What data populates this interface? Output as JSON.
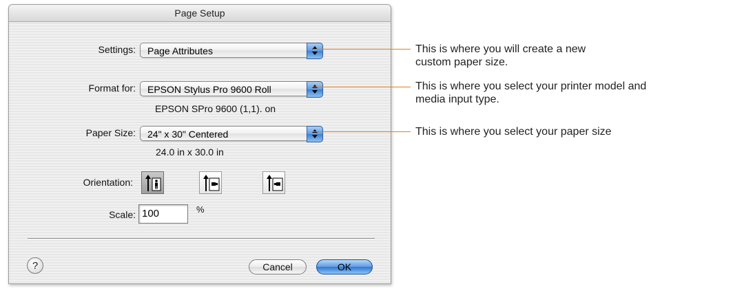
{
  "dialog": {
    "title": "Page Setup",
    "settings": {
      "label": "Settings:",
      "value": "Page Attributes"
    },
    "format_for": {
      "label": "Format for:",
      "value": "EPSON Stylus Pro 9600 Roll",
      "info": "EPSON SPro 9600 (1,1). on"
    },
    "paper_size": {
      "label": "Paper Size:",
      "value": "24\" x 30\" Centered",
      "info": "24.0 in x 30.0 in"
    },
    "orientation": {
      "label": "Orientation:",
      "options": [
        "portrait-icon",
        "landscape-icon",
        "reverse-landscape-icon"
      ],
      "selected": 0
    },
    "scale": {
      "label": "Scale:",
      "value": "100",
      "unit": "%"
    },
    "help_label": "?",
    "cancel_label": "Cancel",
    "ok_label": "OK"
  },
  "annotations": {
    "settings": [
      "This is where you will create a new",
      "custom paper size."
    ],
    "format_for": [
      "This is where you select your printer model and",
      "media input type."
    ],
    "paper_size": [
      "This is where you select your paper size"
    ]
  },
  "colors": {
    "leader_line": "#f07b12",
    "ok_button": "#2f76d0",
    "popup_arrows": "#3d7fd2"
  }
}
